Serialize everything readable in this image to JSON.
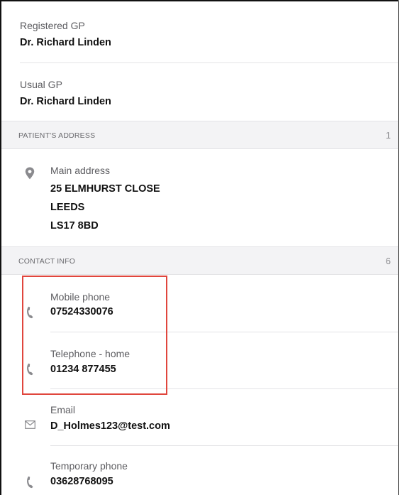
{
  "gp": {
    "registered": {
      "label": "Registered GP",
      "value": "Dr. Richard Linden"
    },
    "usual": {
      "label": "Usual GP",
      "value": "Dr. Richard Linden"
    }
  },
  "address_section": {
    "title": "PATIENT'S ADDRESS",
    "count": "1",
    "item": {
      "label": "Main address",
      "lines": [
        "25 ELMHURST CLOSE",
        "LEEDS",
        "LS17 8BD"
      ],
      "icon": "location-pin-icon"
    }
  },
  "contact_section": {
    "title": "CONTACT INFO",
    "count": "6",
    "items": [
      {
        "label": "Mobile phone",
        "value": "07524330076",
        "icon": "phone-icon"
      },
      {
        "label": "Telephone - home",
        "value": "01234 877455",
        "icon": "phone-icon"
      },
      {
        "label": "Email",
        "value": "D_Holmes123@test.com",
        "icon": "mail-icon"
      },
      {
        "label": "Temporary phone",
        "value": "03628768095",
        "icon": "phone-icon"
      }
    ]
  },
  "colors": {
    "highlight": "#e0463d",
    "icon": "#8a8a8e",
    "section_bg": "#f3f3f5"
  }
}
